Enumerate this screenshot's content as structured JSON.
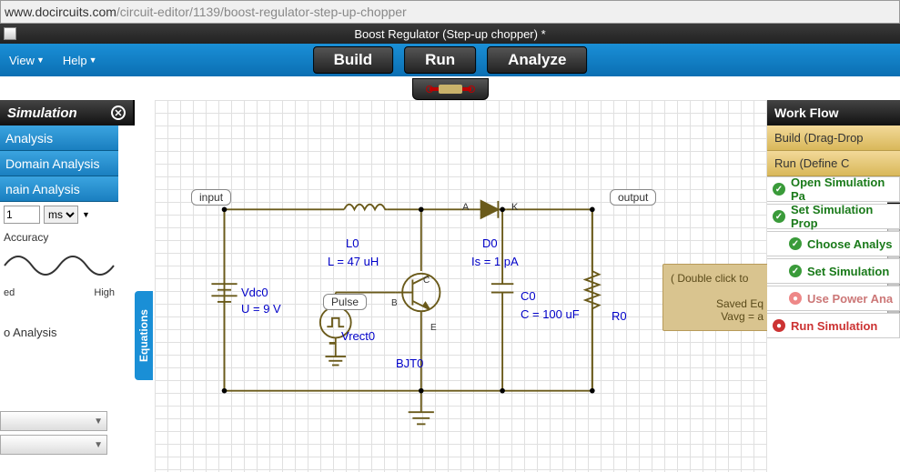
{
  "url": {
    "host": "www.docircuits.com",
    "path": "/circuit-editor/1139/boost-regulator-step-up-chopper"
  },
  "title": "Boost Regulator (Step-up chopper) *",
  "menu": {
    "view": "View",
    "help": "Help"
  },
  "buttons": {
    "build": "Build",
    "run": "Run",
    "analyze": "Analyze"
  },
  "sim": {
    "header": "Simulation",
    "items": [
      "Analysis",
      "Domain Analysis",
      "nain Analysis"
    ],
    "param_value": "1",
    "param_unit": "ms",
    "accuracy": "Accuracy",
    "low": "ed",
    "high": "High",
    "o_analysis": "o Analysis"
  },
  "equations": "Equations",
  "circuit": {
    "input": "input",
    "output": "output",
    "pulse": "Pulse",
    "vdc_name": "Vdc0",
    "vdc_val": "U = 9 V",
    "l_name": "L0",
    "l_val": "L = 47 uH",
    "d_name": "D0",
    "d_val": "Is = 1 pA",
    "d_a": "A",
    "d_k": "K",
    "c_name": "C0",
    "c_val": "C = 100 uF",
    "r_name": "R0",
    "vrect": "Vrect0",
    "bjt": "BJT0",
    "bjt_b": "B",
    "bjt_c": "C",
    "bjt_e": "E"
  },
  "note": {
    "l1": "( Double click to",
    "l2": "Saved Eq",
    "l3": "Vavg = a"
  },
  "workflow": {
    "header": "Work Flow",
    "build": "Build (Drag-Drop",
    "run": "Run (Define C",
    "steps": [
      {
        "label": "Open Simulation Pa",
        "color": "green",
        "indent": false
      },
      {
        "label": "Set Simulation Prop",
        "color": "green",
        "indent": false
      },
      {
        "label": "Choose Analys",
        "color": "green",
        "indent": true
      },
      {
        "label": "Set Simulation",
        "color": "green",
        "indent": true
      },
      {
        "label": "Use Power Ana",
        "color": "pink",
        "indent": true
      },
      {
        "label": "Run Simulation",
        "color": "red",
        "indent": false
      }
    ]
  }
}
